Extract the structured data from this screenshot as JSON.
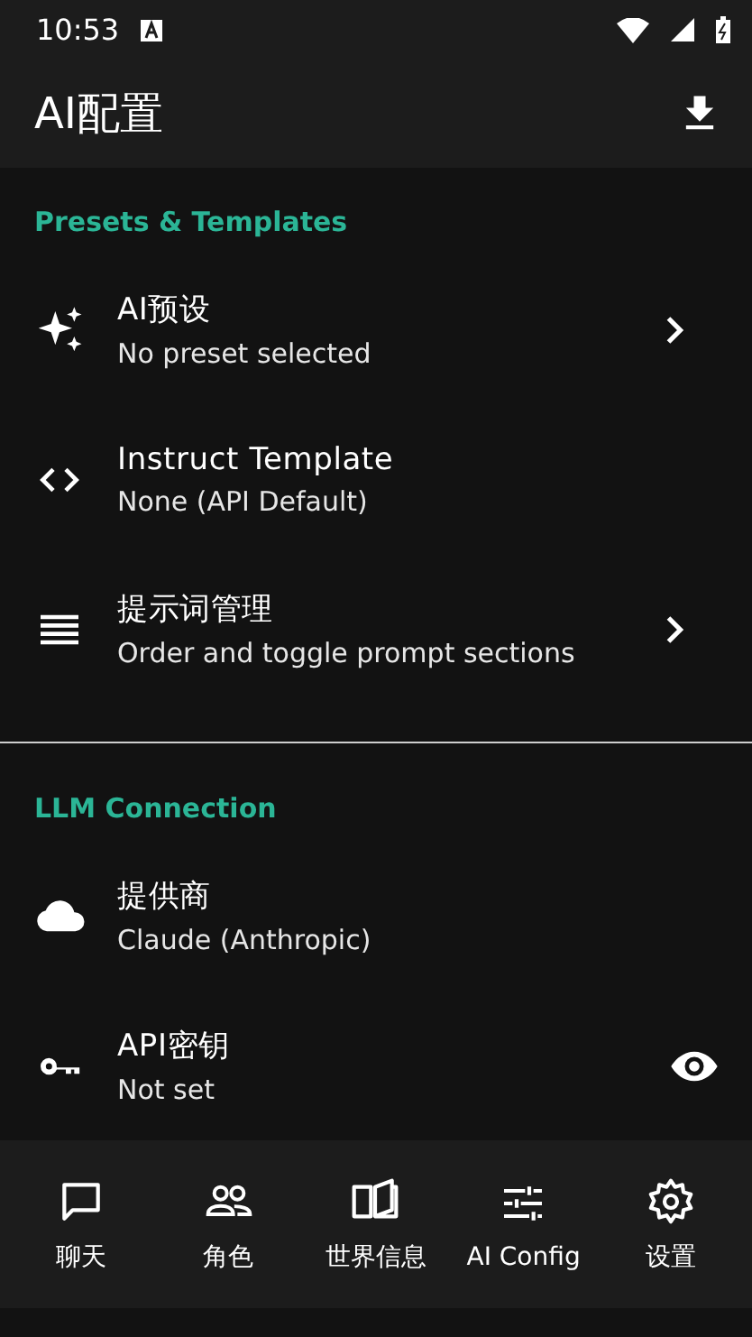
{
  "status_bar": {
    "time": "10:53"
  },
  "app_bar": {
    "title": "AI配置"
  },
  "sections": [
    {
      "title": "Presets & Templates",
      "items": [
        {
          "title": "AI预设",
          "subtitle": "No preset selected",
          "kind": "chevron"
        },
        {
          "title": "Instruct Template",
          "subtitle": "None (API Default)",
          "kind": "plain"
        },
        {
          "title": "提示词管理",
          "subtitle": "Order and toggle prompt sections",
          "kind": "chevron"
        }
      ]
    },
    {
      "title": "LLM Connection",
      "items": [
        {
          "title": "提供商",
          "subtitle": "Claude (Anthropic)",
          "kind": "plain"
        },
        {
          "title": "API密钥",
          "subtitle": "Not set",
          "kind": "eye"
        }
      ]
    }
  ],
  "bottom_nav": [
    {
      "label": "聊天"
    },
    {
      "label": "角色"
    },
    {
      "label": "世界信息"
    },
    {
      "label": "AI Config"
    },
    {
      "label": "设置"
    }
  ]
}
